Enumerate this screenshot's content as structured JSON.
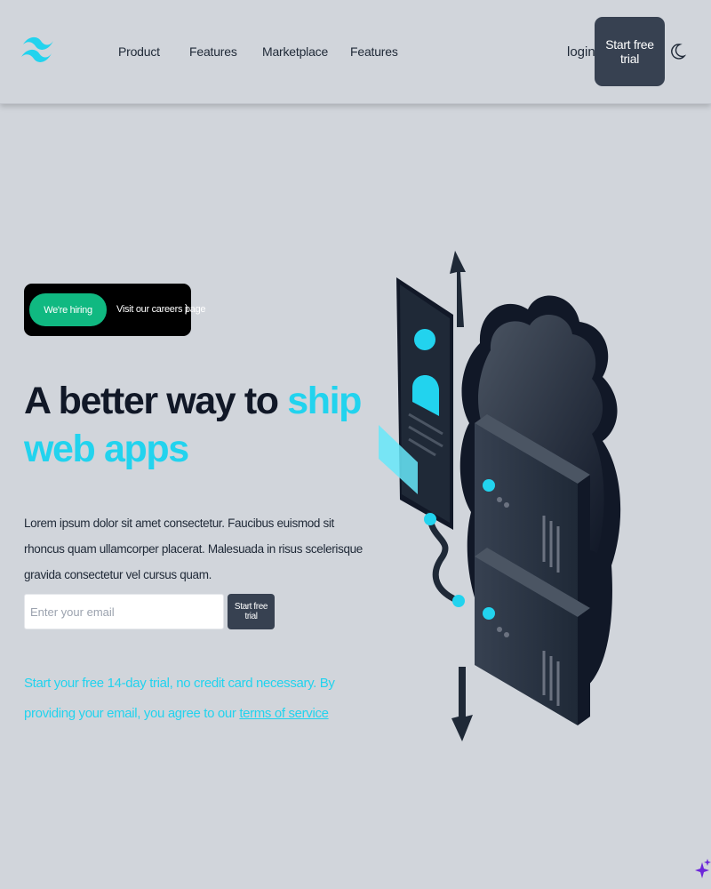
{
  "header": {
    "logo": "tailwind-wave-logo",
    "nav": [
      "Product",
      "Features",
      "Marketplace",
      "Features"
    ],
    "login_label": "login",
    "trial_label": "Start free trial",
    "theme_icon": "moon-icon"
  },
  "hero": {
    "badge": {
      "tag": "We're hiring",
      "text": "Visit our careers page",
      "chevron": ")"
    },
    "headline_part1": "A better way to ",
    "headline_accent": "ship web apps",
    "lead": "Lorem ipsum dolor sit amet consectetur. Faucibus euismod sit rhoncus quam ullamcorper placerat. Malesuada in risus scelerisque gravida consectetur vel cursus quam.",
    "form": {
      "email_placeholder": "Enter your email",
      "submit_label": "Start free trial"
    },
    "fine_print": "Start your free 14-day trial, no credit card necessary. By providing your email, you agree to our ",
    "terms_link": "terms of service",
    "illustration": "cloud-server-upload-illustration"
  },
  "colors": {
    "background": "#d1d5db",
    "accent": "#22d3ee",
    "dark_button": "#374151",
    "hiring_green": "#10b981",
    "text": "#111827"
  },
  "corner_icon": "sparkle-icon"
}
